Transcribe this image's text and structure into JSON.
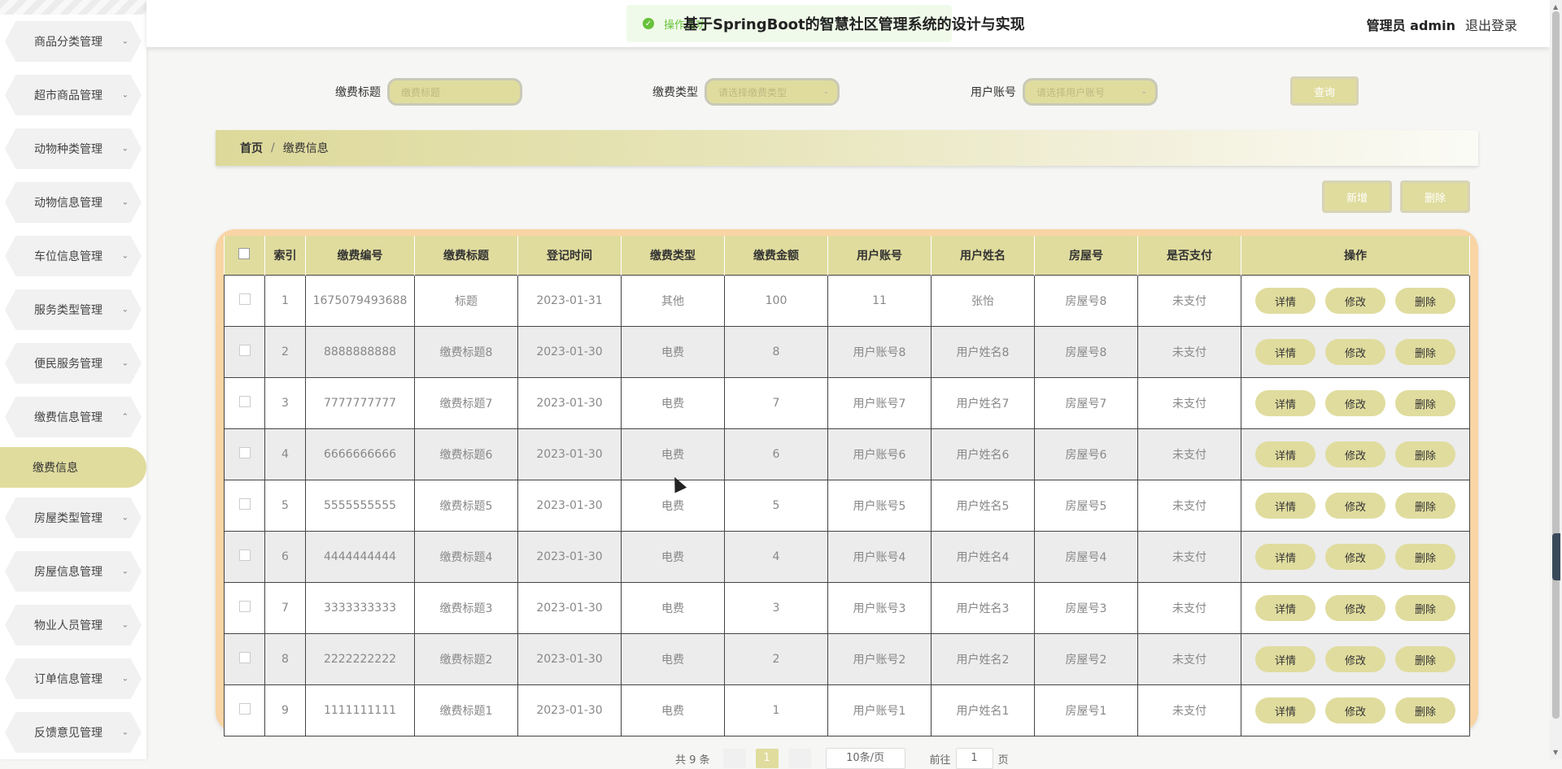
{
  "sidebar": {
    "items": [
      {
        "label": "商品分类管理"
      },
      {
        "label": "超市商品管理"
      },
      {
        "label": "动物种类管理"
      },
      {
        "label": "动物信息管理"
      },
      {
        "label": "车位信息管理"
      },
      {
        "label": "服务类型管理"
      },
      {
        "label": "便民服务管理"
      },
      {
        "label": "缴费信息管理"
      },
      {
        "label": "房屋类型管理"
      },
      {
        "label": "房屋信息管理"
      },
      {
        "label": "物业人员管理"
      },
      {
        "label": "订单信息管理"
      },
      {
        "label": "反馈意见管理"
      }
    ],
    "active_sub": "缴费信息"
  },
  "header": {
    "title": "基于SpringBoot的智慧社区管理系统的设计与实现",
    "user": "管理员 admin",
    "logout": "退出登录",
    "toast": "操作成功"
  },
  "search": {
    "f1_label": "缴费标题",
    "f1_placeholder": "缴费标题",
    "f2_label": "缴费类型",
    "f2_placeholder": "请选择缴费类型",
    "f3_label": "用户账号",
    "f3_placeholder": "请选择用户账号",
    "query": "查询"
  },
  "breadcrumb": {
    "home": "首页",
    "sep": "/",
    "current": "缴费信息"
  },
  "actions": {
    "add": "新增",
    "delete": "删除"
  },
  "table": {
    "columns": {
      "index": "索引",
      "code": "缴费编号",
      "title": "缴费标题",
      "date": "登记时间",
      "type": "缴费类型",
      "amount": "缴费金额",
      "account": "用户账号",
      "name": "用户姓名",
      "house": "房屋号",
      "paid": "是否支付",
      "ops": "操作"
    },
    "buttons": {
      "detail": "详情",
      "edit": "修改",
      "del": "删除"
    },
    "rows": [
      {
        "index": "1",
        "code": "1675079493688",
        "title": "标题",
        "date": "2023-01-31",
        "type": "其他",
        "amount": "100",
        "account": "11",
        "name": "张怡",
        "house": "房屋号8",
        "paid": "未支付"
      },
      {
        "index": "2",
        "code": "8888888888",
        "title": "缴费标题8",
        "date": "2023-01-30",
        "type": "电费",
        "amount": "8",
        "account": "用户账号8",
        "name": "用户姓名8",
        "house": "房屋号8",
        "paid": "未支付"
      },
      {
        "index": "3",
        "code": "7777777777",
        "title": "缴费标题7",
        "date": "2023-01-30",
        "type": "电费",
        "amount": "7",
        "account": "用户账号7",
        "name": "用户姓名7",
        "house": "房屋号7",
        "paid": "未支付"
      },
      {
        "index": "4",
        "code": "6666666666",
        "title": "缴费标题6",
        "date": "2023-01-30",
        "type": "电费",
        "amount": "6",
        "account": "用户账号6",
        "name": "用户姓名6",
        "house": "房屋号6",
        "paid": "未支付"
      },
      {
        "index": "5",
        "code": "5555555555",
        "title": "缴费标题5",
        "date": "2023-01-30",
        "type": "电费",
        "amount": "5",
        "account": "用户账号5",
        "name": "用户姓名5",
        "house": "房屋号5",
        "paid": "未支付"
      },
      {
        "index": "6",
        "code": "4444444444",
        "title": "缴费标题4",
        "date": "2023-01-30",
        "type": "电费",
        "amount": "4",
        "account": "用户账号4",
        "name": "用户姓名4",
        "house": "房屋号4",
        "paid": "未支付"
      },
      {
        "index": "7",
        "code": "3333333333",
        "title": "缴费标题3",
        "date": "2023-01-30",
        "type": "电费",
        "amount": "3",
        "account": "用户账号3",
        "name": "用户姓名3",
        "house": "房屋号3",
        "paid": "未支付"
      },
      {
        "index": "8",
        "code": "2222222222",
        "title": "缴费标题2",
        "date": "2023-01-30",
        "type": "电费",
        "amount": "2",
        "account": "用户账号2",
        "name": "用户姓名2",
        "house": "房屋号2",
        "paid": "未支付"
      },
      {
        "index": "9",
        "code": "1111111111",
        "title": "缴费标题1",
        "date": "2023-01-30",
        "type": "电费",
        "amount": "1",
        "account": "用户账号1",
        "name": "用户姓名1",
        "house": "房屋号1",
        "paid": "未支付"
      }
    ]
  },
  "pagination": {
    "total": "共 9 条",
    "page": "1",
    "size": "10条/页",
    "goto": "前往",
    "goto_value": "1",
    "page_unit": "页"
  },
  "colors": {
    "accent": "#e0dc9e",
    "table_frame": "#f9d4a4",
    "success": "#67c23a"
  }
}
